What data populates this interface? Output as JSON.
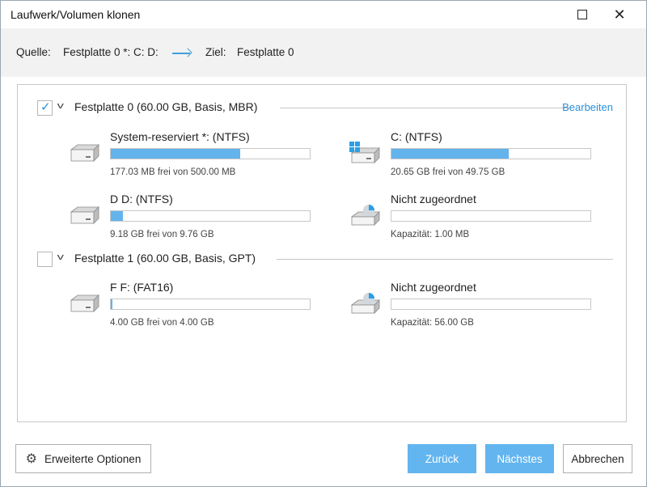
{
  "window": {
    "title": "Laufwerk/Volumen klonen"
  },
  "source": {
    "label": "Quelle:",
    "value": "Festplatte 0 *: C: D:",
    "target_label": "Ziel:",
    "target_value": "Festplatte 0"
  },
  "disks": [
    {
      "title": "Festplatte 0 (60.00 GB, Basis, MBR)",
      "checked": true,
      "edit_label": "Bearbeiten",
      "partitions": [
        {
          "name": "System-reserviert *: (NTFS)",
          "info": "177.03 MB frei von 500.00 MB",
          "used_fraction": 0.65,
          "icon": "drive-icon"
        },
        {
          "name": "C: (NTFS)",
          "info": "20.65 GB frei von 49.75 GB",
          "used_fraction": 0.59,
          "icon": "windows-drive-icon"
        },
        {
          "name": "D D: (NTFS)",
          "info": "9.18 GB frei von 9.76 GB",
          "used_fraction": 0.06,
          "icon": "drive-icon"
        },
        {
          "name": "Nicht zugeordnet",
          "info": "Kapazität: 1.00 MB",
          "used_fraction": 0.0,
          "icon": "unallocated-disk-icon"
        }
      ]
    },
    {
      "title": "Festplatte 1 (60.00 GB, Basis, GPT)",
      "checked": false,
      "partitions": [
        {
          "name": "F F: (FAT16)",
          "info": "4.00 GB frei von 4.00 GB",
          "used_fraction": 0.004,
          "icon": "drive-icon"
        },
        {
          "name": "Nicht zugeordnet",
          "info": "Kapazität: 56.00 GB",
          "used_fraction": 0.0,
          "icon": "unallocated-disk-icon"
        }
      ]
    }
  ],
  "buttons": {
    "advanced": "Erweiterte Optionen",
    "back": "Zurück",
    "next": "Nächstes",
    "cancel": "Abbrechen"
  },
  "colors": {
    "accent": "#62b5ef",
    "link": "#2a8fd9",
    "bar_fill": "#63b3ec"
  }
}
